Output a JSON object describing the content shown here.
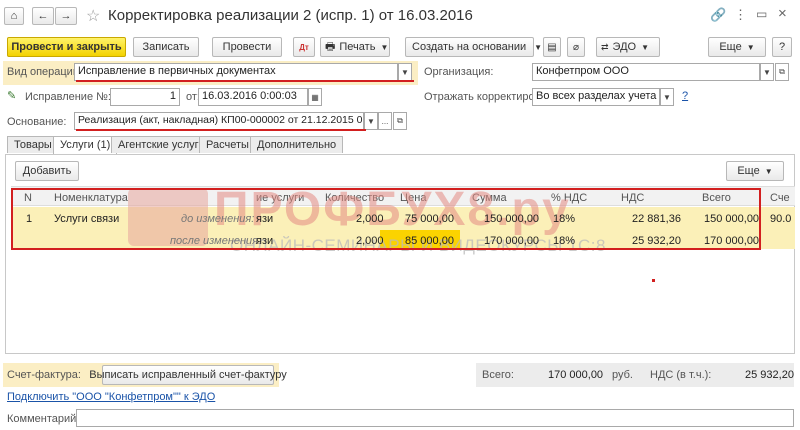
{
  "window": {
    "title": "Корректировка реализации 2 (испр. 1) от 16.03.2016"
  },
  "toolbar": {
    "post_close": "Провести и закрыть",
    "save": "Записать",
    "post": "Провести",
    "print": "Печать",
    "create_based": "Создать на основании",
    "edo": "ЭДО",
    "more": "Еще",
    "help": "?"
  },
  "form": {
    "operation_label": "Вид операции:",
    "operation_value": "Исправление в первичных документах",
    "org_label": "Организация:",
    "org_value": "Конфетпром ООО",
    "correction_label": "Исправление №:",
    "correction_value": "1",
    "from_label": "от:",
    "correction_date": "16.03.2016  0:00:03",
    "reflect_label": "Отражать корректировку:",
    "reflect_value": "Во всех разделах учета",
    "basis_label": "Основание:",
    "basis_value": "Реализация (акт, накладная) КП00-000002 от 21.12.2015 0:00:00",
    "ellipsis": "..."
  },
  "tabs": [
    "Товары",
    "Услуги (1)",
    "Агентские услуги",
    "Расчеты",
    "Дополнительно"
  ],
  "table": {
    "add_button": "Добавить",
    "more_button": "Еще",
    "headers": [
      "N",
      "Номенклатура",
      "ие услуги",
      "Количество",
      "Цена",
      "Сумма",
      "% НДС",
      "НДС",
      "Всего",
      "Сче"
    ],
    "row": {
      "n": "1",
      "item": "Услуги связи",
      "before_label": "до изменения:",
      "after_label": "после изменения:",
      "content_before": "язи",
      "content_after": "язи",
      "qty_before": "2,000",
      "qty_after": "2,000",
      "price_before": "75 000,00",
      "price_after": "85 000,00",
      "sum_before": "150 000,00",
      "sum_after": "170 000,00",
      "vat_before": "18%",
      "vat_after": "18%",
      "vat_amount_before": "22 881,36",
      "vat_amount_after": "25 932,20",
      "total_before": "150 000,00",
      "total_after": "170 000,00",
      "account": "90.0"
    }
  },
  "watermark": {
    "brand": "ПРОФБУХ8.ру",
    "tagline": "ОНЛАЙН-СЕМИНАРЫ И ВИДЕОКУРСЫ 1С:8"
  },
  "footer": {
    "invoice_label": "Счет-фактура:",
    "invoice_button": "Выписать исправленный счет-фактуру",
    "edo_link": "Подключить \"ООО \"Конфетпром\"\" к ЭДО",
    "total_label": "Всего:",
    "total_value": "170 000,00",
    "currency": "руб.",
    "vat_label": "НДС (в т.ч.):",
    "vat_value": "25 932,20",
    "comment_label": "Комментарий:"
  },
  "colors": {
    "accent_yellow": "#f3d200",
    "highlight_red": "#d21f1f",
    "row_yellow": "#fbf0b8"
  }
}
